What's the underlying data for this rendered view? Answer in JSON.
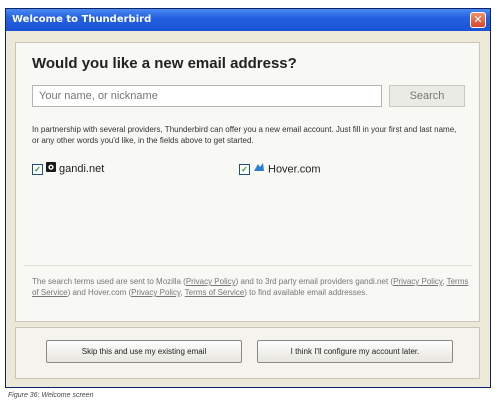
{
  "window": {
    "title": "Welcome to Thunderbird",
    "close_glyph": "✕"
  },
  "main": {
    "heading": "Would you like a new email address?",
    "search": {
      "placeholder": "Your name, or nickname",
      "button_label": "Search"
    },
    "info_text": "In partnership with several providers, Thunderbird can offer you a new email account. Just fill in your first and last name, or any other words you'd like, in the fields above to get started.",
    "providers": [
      {
        "name": "gandi.net",
        "checked": true,
        "icon": "gandi-logo-icon"
      },
      {
        "name": "Hover.com",
        "checked": true,
        "icon": "hover-logo-icon"
      }
    ],
    "footer": {
      "t1": "The search terms used are sent to Mozilla (",
      "l1": "Privacy Policy",
      "t2": ") and to 3rd party email providers gandi.net (",
      "l2": "Privacy Policy",
      "t3": ", ",
      "l3": "Terms of Service",
      "t4": ") and Hover.com (",
      "l4": "Privacy Policy",
      "t5": ", ",
      "l5": "Terms of Service",
      "t6": ") to find available email addresses."
    }
  },
  "buttons": {
    "skip": "Skip this and use my existing email",
    "configure": "I think I'll configure my account later."
  },
  "caption": "Figure 36: Welcome screen"
}
